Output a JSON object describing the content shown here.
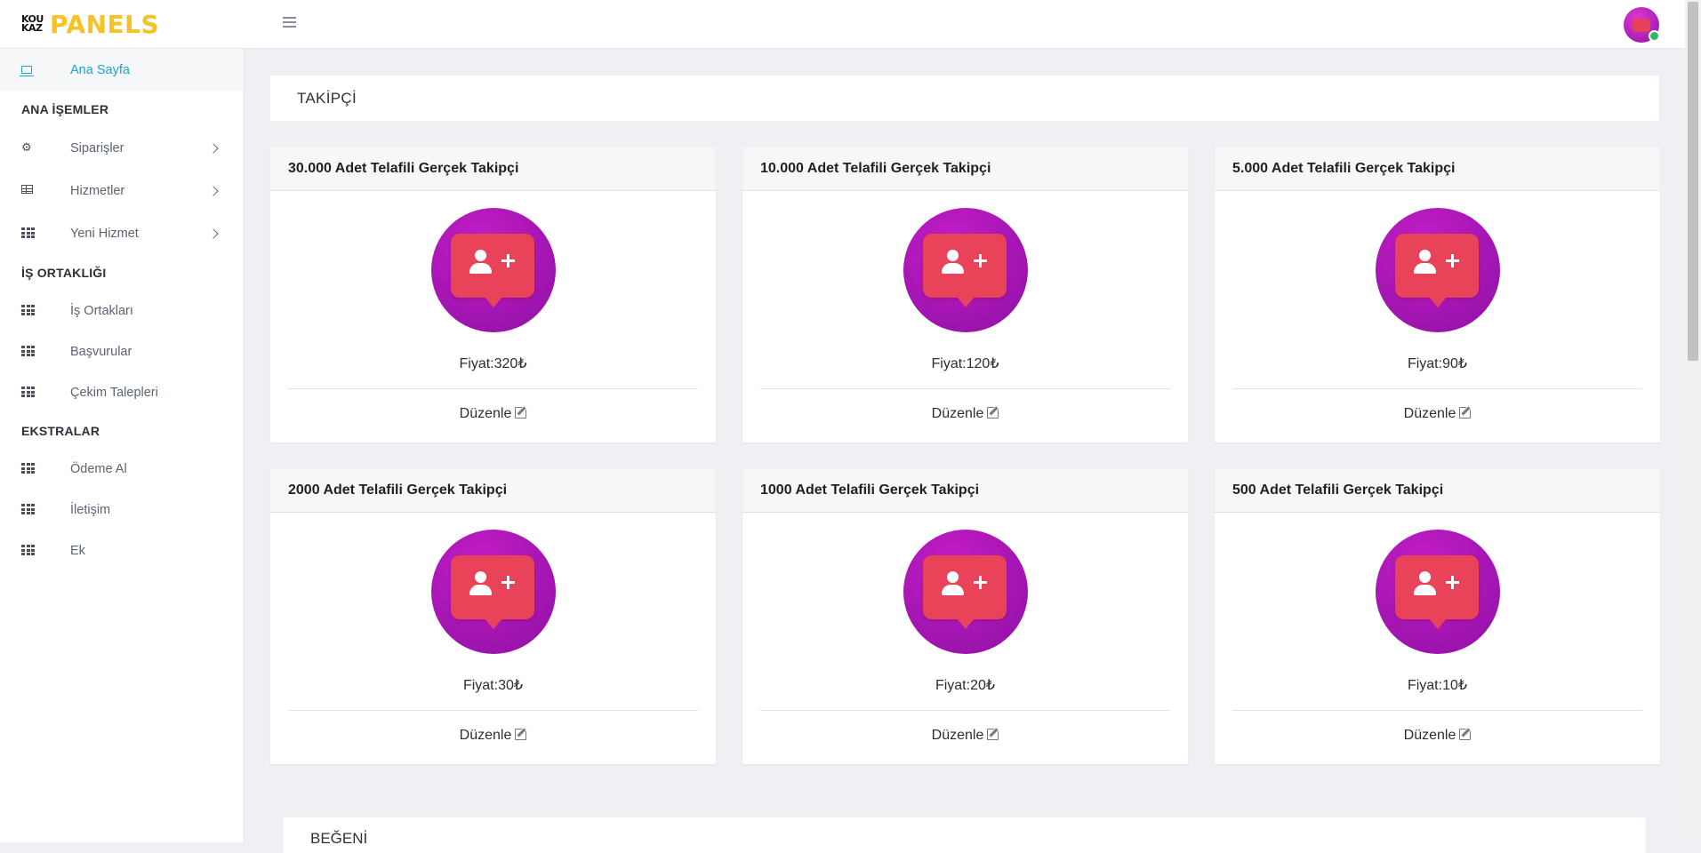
{
  "brand": {
    "mark": "KOU KAZ",
    "name": "PANELS"
  },
  "sidebar": {
    "home": {
      "label": "Ana Sayfa",
      "icon": "laptop-icon"
    },
    "sections": [
      {
        "title": "ANA İŞEMLER",
        "items": [
          {
            "label": "Siparişler",
            "icon": "cogs-icon",
            "has_submenu": true
          },
          {
            "label": "Hizmetler",
            "icon": "table-icon",
            "has_submenu": true
          },
          {
            "label": "Yeni Hizmet",
            "icon": "grid-icon",
            "has_submenu": true
          }
        ]
      },
      {
        "title": "İŞ ORTAKLIĞI",
        "items": [
          {
            "label": "İş Ortakları",
            "icon": "grid-icon"
          },
          {
            "label": "Başvurular",
            "icon": "grid-icon"
          },
          {
            "label": "Çekim Talepleri",
            "icon": "grid-icon"
          }
        ]
      },
      {
        "title": "EKSTRALAR",
        "items": [
          {
            "label": "Ödeme Al",
            "icon": "grid-icon"
          },
          {
            "label": "İletişim",
            "icon": "grid-icon"
          },
          {
            "label": "Ek",
            "icon": "grid-icon"
          }
        ]
      }
    ]
  },
  "main": {
    "section_title": "TAKİPÇİ",
    "cards": [
      {
        "title": "30.000 Adet Telafili Gerçek Takipçi",
        "price": "Fiyat:320₺",
        "action": "Düzenle"
      },
      {
        "title": "10.000 Adet Telafili Gerçek Takipçi",
        "price": "Fiyat:120₺",
        "action": "Düzenle"
      },
      {
        "title": "5.000 Adet Telafili Gerçek Takipçi",
        "price": "Fiyat:90₺",
        "action": "Düzenle"
      },
      {
        "title": "2000 Adet Telafili Gerçek Takipçi",
        "price": "Fiyat:30₺",
        "action": "Düzenle"
      },
      {
        "title": "1000 Adet Telafili Gerçek Takipçi",
        "price": "Fiyat:20₺",
        "action": "Düzenle"
      },
      {
        "title": "500 Adet Telafili Gerçek Takipçi",
        "price": "Fiyat:10₺",
        "action": "Düzenle"
      }
    ],
    "next_section_title": "BEĞENİ"
  },
  "colors": {
    "accent": "#1aa3d8",
    "brand_yellow": "#f7c223",
    "badge_purple": "#a616b4",
    "bubble_red": "#e9435a"
  }
}
